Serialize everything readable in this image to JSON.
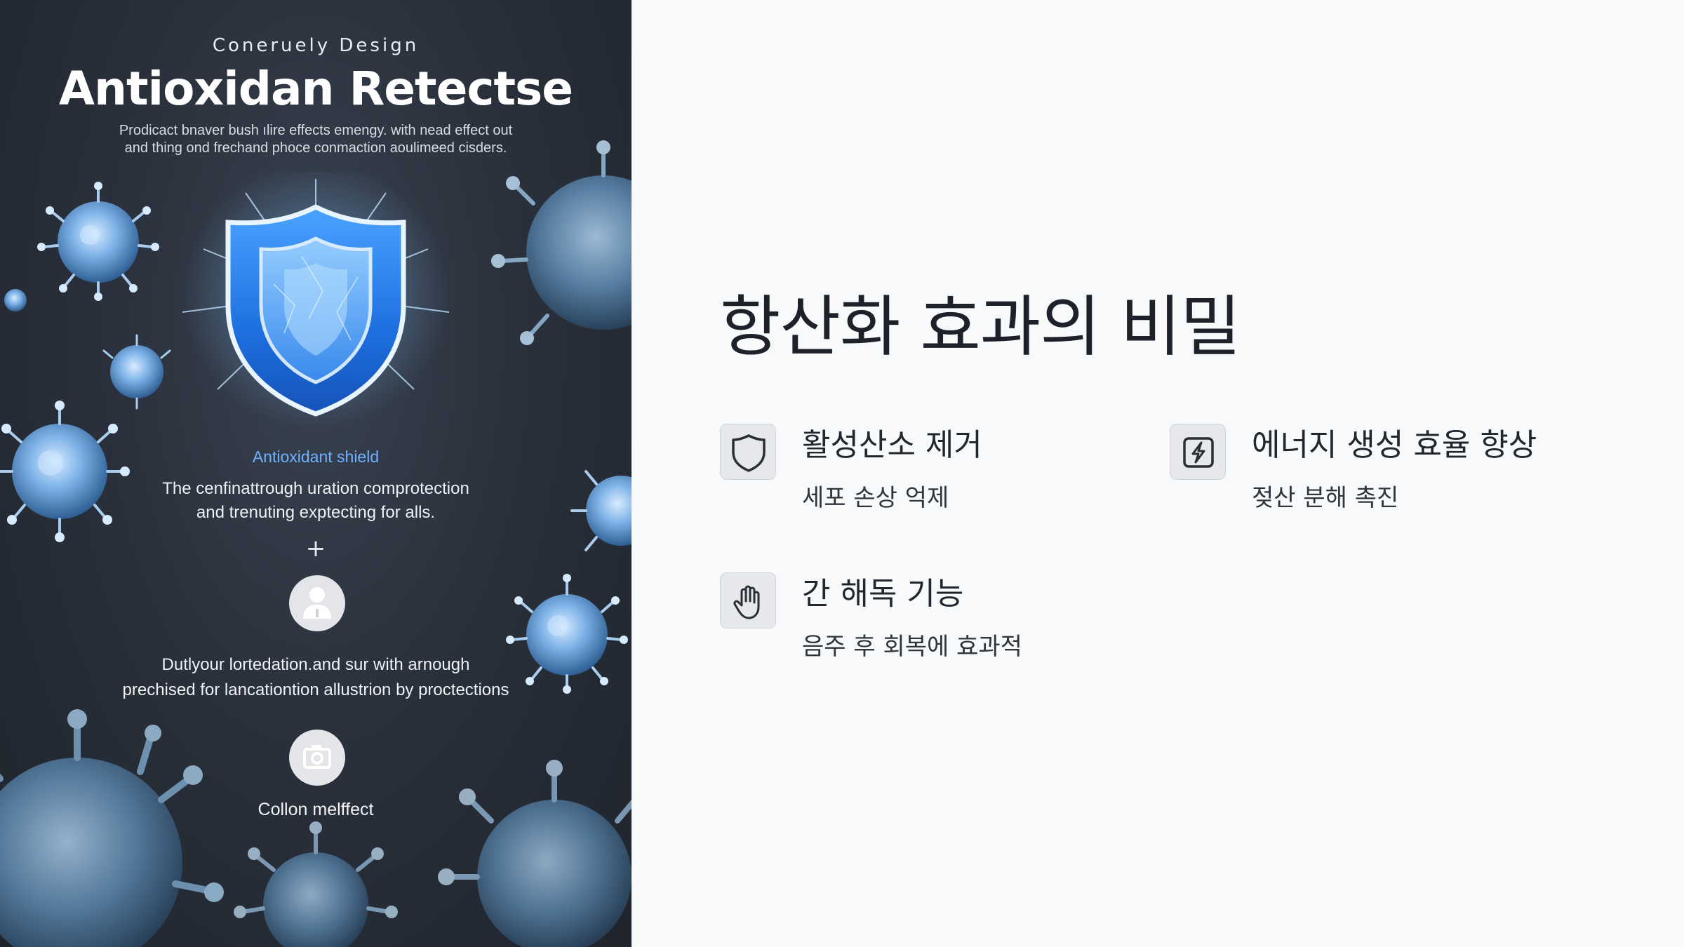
{
  "poster": {
    "kicker": "Coneruely Design",
    "title": "Antioxidan Retectse",
    "description_line1": "Prodicact bnaver bush ılire effects emengy. with nead effect out",
    "description_line2": "and thing ond frechand phoce conmaction aoulimeed cisders.",
    "shield_caption": "Antioxidant shield",
    "shield_desc_line1": "The cenfinattrough uration comprotection",
    "shield_desc_line2": "and trenuting exptecting for alls.",
    "plus": "+",
    "person_desc_line1": "Dutlyour lortedation.and sur with arnough",
    "person_desc_line2": "prechised for lancationtion allustrion by proctections",
    "camera_caption": "Collon melffect",
    "accent_color": "#6fb0ff"
  },
  "main": {
    "title": "항산화 효과의 비밀",
    "features": [
      {
        "icon": "shield-icon",
        "title": "활성산소 제거",
        "desc": "세포 손상 억제"
      },
      {
        "icon": "lightning-icon",
        "title": "에너지 생성 효율 향상",
        "desc": "젖산 분해 촉진"
      },
      {
        "icon": "hand-icon",
        "title": "간 해독 기능",
        "desc": "음주 후 회복에 효과적"
      }
    ]
  }
}
